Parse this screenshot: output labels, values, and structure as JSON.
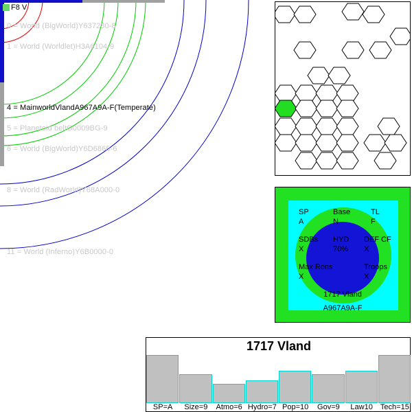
{
  "star": {
    "label": "F8 V",
    "color": "#66d966"
  },
  "orbits": {
    "items": [
      {
        "text": "0 = World  (BigWorld)Y637230-8",
        "main": false
      },
      {
        "text": "1 = World  (Worldlet)H3A6104-9",
        "main": false
      },
      {
        "text": "4 = MainworldVlandA967A9A-F(Temperate)",
        "main": true
      },
      {
        "text": "5 = Planetoid beltG0009BG-9",
        "main": false
      },
      {
        "text": "6 = World  (BigWorld)Y6D6865-6",
        "main": false
      },
      {
        "text": "8 = World  (RadWorld)Y68A000-0",
        "main": false
      },
      {
        "text": "11 = World  (Inferno)Y6B0000-0",
        "main": false
      }
    ]
  },
  "world_card": {
    "sp_label": "SP",
    "sp_value": "A",
    "base_label": "Base",
    "base_value": "N",
    "tl_label": "TL",
    "tl_value": "F",
    "sdbs_label": "SDBs",
    "sdbs_value": "X",
    "hyd_label": "HYD",
    "hyd_value": "70%",
    "def_label": "DEF CF",
    "def_value": "X",
    "maxrons_label": "Max Rons",
    "maxrons_value": "X",
    "troops_label": "Troops",
    "troops_value": "X",
    "name": "1717 Vland",
    "uwp": "A967A9A-F"
  },
  "chart_data": {
    "type": "bar",
    "title": "1717 Vland",
    "categories": [
      "SP=A",
      "Size=9",
      "Atmo=6",
      "Hydro=7",
      "Pop=10",
      "Gov=9",
      "Law10",
      "Tech=15"
    ],
    "values": [
      15,
      9,
      6,
      7,
      10,
      9,
      10,
      15
    ],
    "ylim": [
      0,
      15
    ]
  },
  "colors": {
    "orbit_red": "#e00000",
    "orbit_green": "#00cc00",
    "orbit_blue": "#0000cc",
    "hex_highlight": "#22dd22",
    "bar_fill": "#c0c0c0",
    "bar_border": "#00d4d4"
  }
}
